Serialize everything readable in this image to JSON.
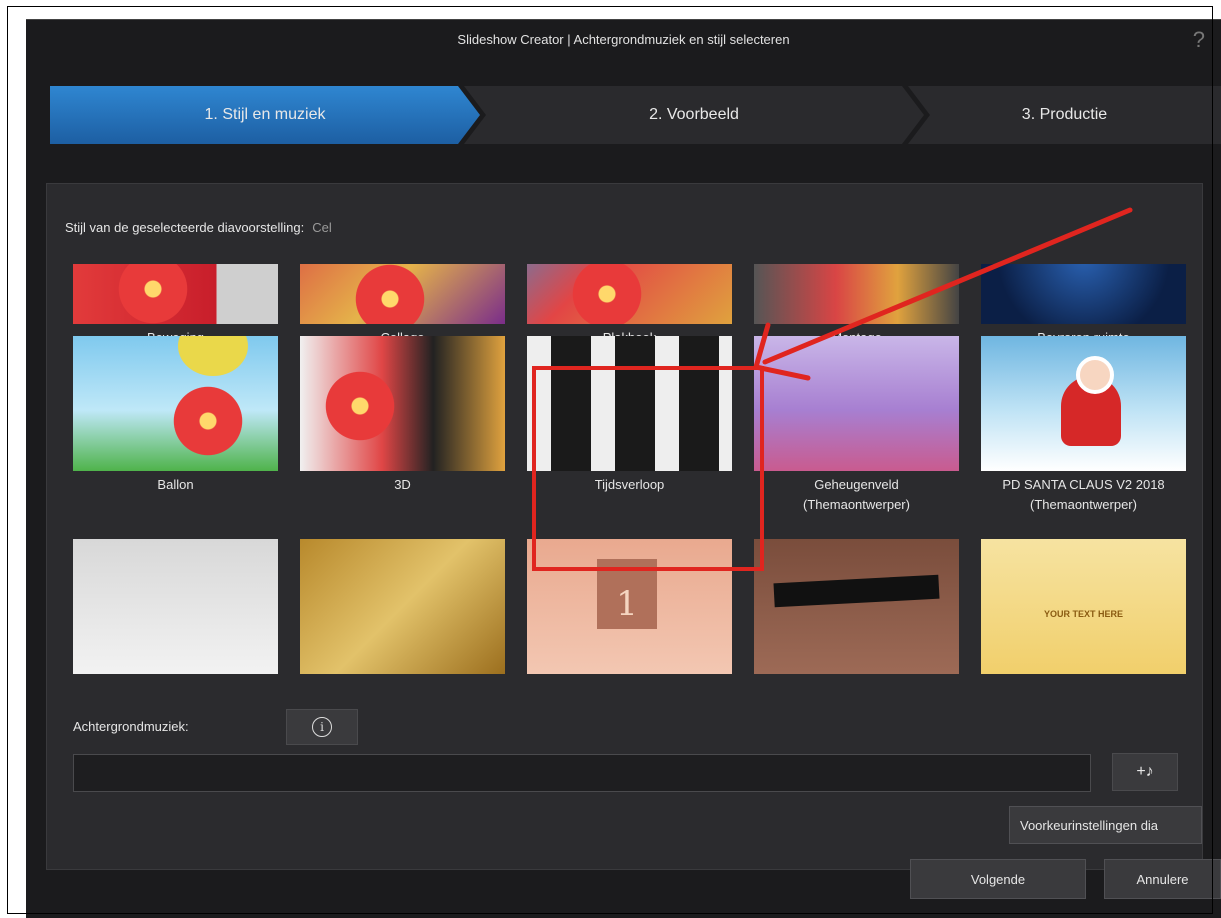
{
  "window": {
    "title": "Slideshow Creator | Achtergrondmuziek en stijl selecteren",
    "help_icon": "?"
  },
  "steps": [
    {
      "label": "1. Stijl en muziek",
      "active": true
    },
    {
      "label": "2. Voorbeeld",
      "active": false
    },
    {
      "label": "3. Productie",
      "active": false
    }
  ],
  "style_section": {
    "label": "Stijl van de geselecteerde diavoorstelling:",
    "value": "Cel"
  },
  "styles": [
    {
      "label": "Beweging",
      "sub": ""
    },
    {
      "label": "Collage",
      "sub": ""
    },
    {
      "label": "Plakboek",
      "sub": ""
    },
    {
      "label": "Montage",
      "sub": ""
    },
    {
      "label": "Bevroren ruimte",
      "sub": ""
    },
    {
      "label": "Ballon",
      "sub": ""
    },
    {
      "label": "3D",
      "sub": ""
    },
    {
      "label": "Tijdsverloop",
      "sub": ""
    },
    {
      "label": "Geheugenveld",
      "sub": "(Themaontwerper)"
    },
    {
      "label": "PD SANTA CLAUS V2 2018",
      "sub": "(Themaontwerper)"
    }
  ],
  "row3_thumbs": {
    "card_number": "1",
    "gold_text": "YOUR TEXT HERE"
  },
  "music": {
    "label": "Achtergrondmuziek:",
    "info_icon": "i",
    "field_value": "",
    "add_button": "+♪"
  },
  "buttons": {
    "preferences": "Voorkeurinstellingen dia",
    "next": "Volgende",
    "cancel": "Annulere"
  },
  "colors": {
    "accent": "#2f86d1",
    "highlight": "#e0251f"
  }
}
